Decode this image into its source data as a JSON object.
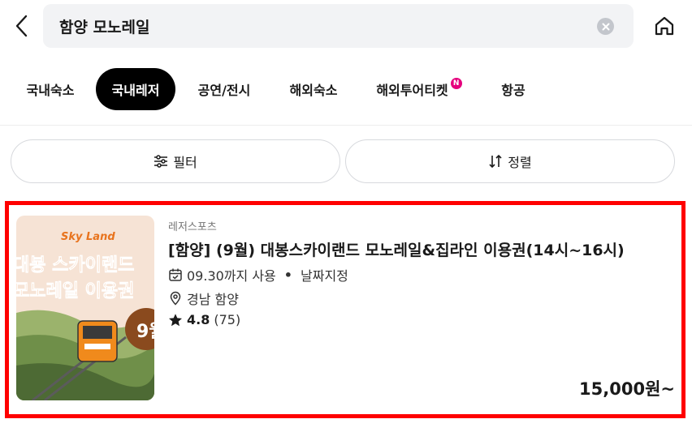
{
  "search": {
    "query": "함양 모노레일"
  },
  "tabs": [
    {
      "label": "국내숙소",
      "active": false,
      "badge": ""
    },
    {
      "label": "국내레저",
      "active": true,
      "badge": ""
    },
    {
      "label": "공연/전시",
      "active": false,
      "badge": ""
    },
    {
      "label": "해외숙소",
      "active": false,
      "badge": ""
    },
    {
      "label": "해외투어티켓",
      "active": false,
      "badge": "N"
    },
    {
      "label": "항공",
      "active": false,
      "badge": ""
    }
  ],
  "filters": {
    "filter_label": "필터",
    "sort_label": "정렬"
  },
  "product": {
    "category": "레저스포츠",
    "title": "[함양] (9월) 대봉스카이랜드 모노레일&집라인 이용권(14시~16시)",
    "valid_until": "09.30까지 사용",
    "date_option": "날짜지정",
    "location": "경남 함양",
    "rating": "4.8",
    "review_count": "(75)",
    "price": "15,000원~",
    "thumbnail": {
      "brand": "Sky Land",
      "line1": "대봉 스카이랜드",
      "line2": "모노레일 이용권",
      "month_badge": "9월"
    }
  },
  "colors": {
    "active_tab_bg": "#000000",
    "new_badge": "#e5007d",
    "highlight_border": "#ff0000",
    "thumb_bg": "#f6e3d5",
    "thumb_text": "#e8731d",
    "thumb_badge": "#8a4a1e"
  }
}
